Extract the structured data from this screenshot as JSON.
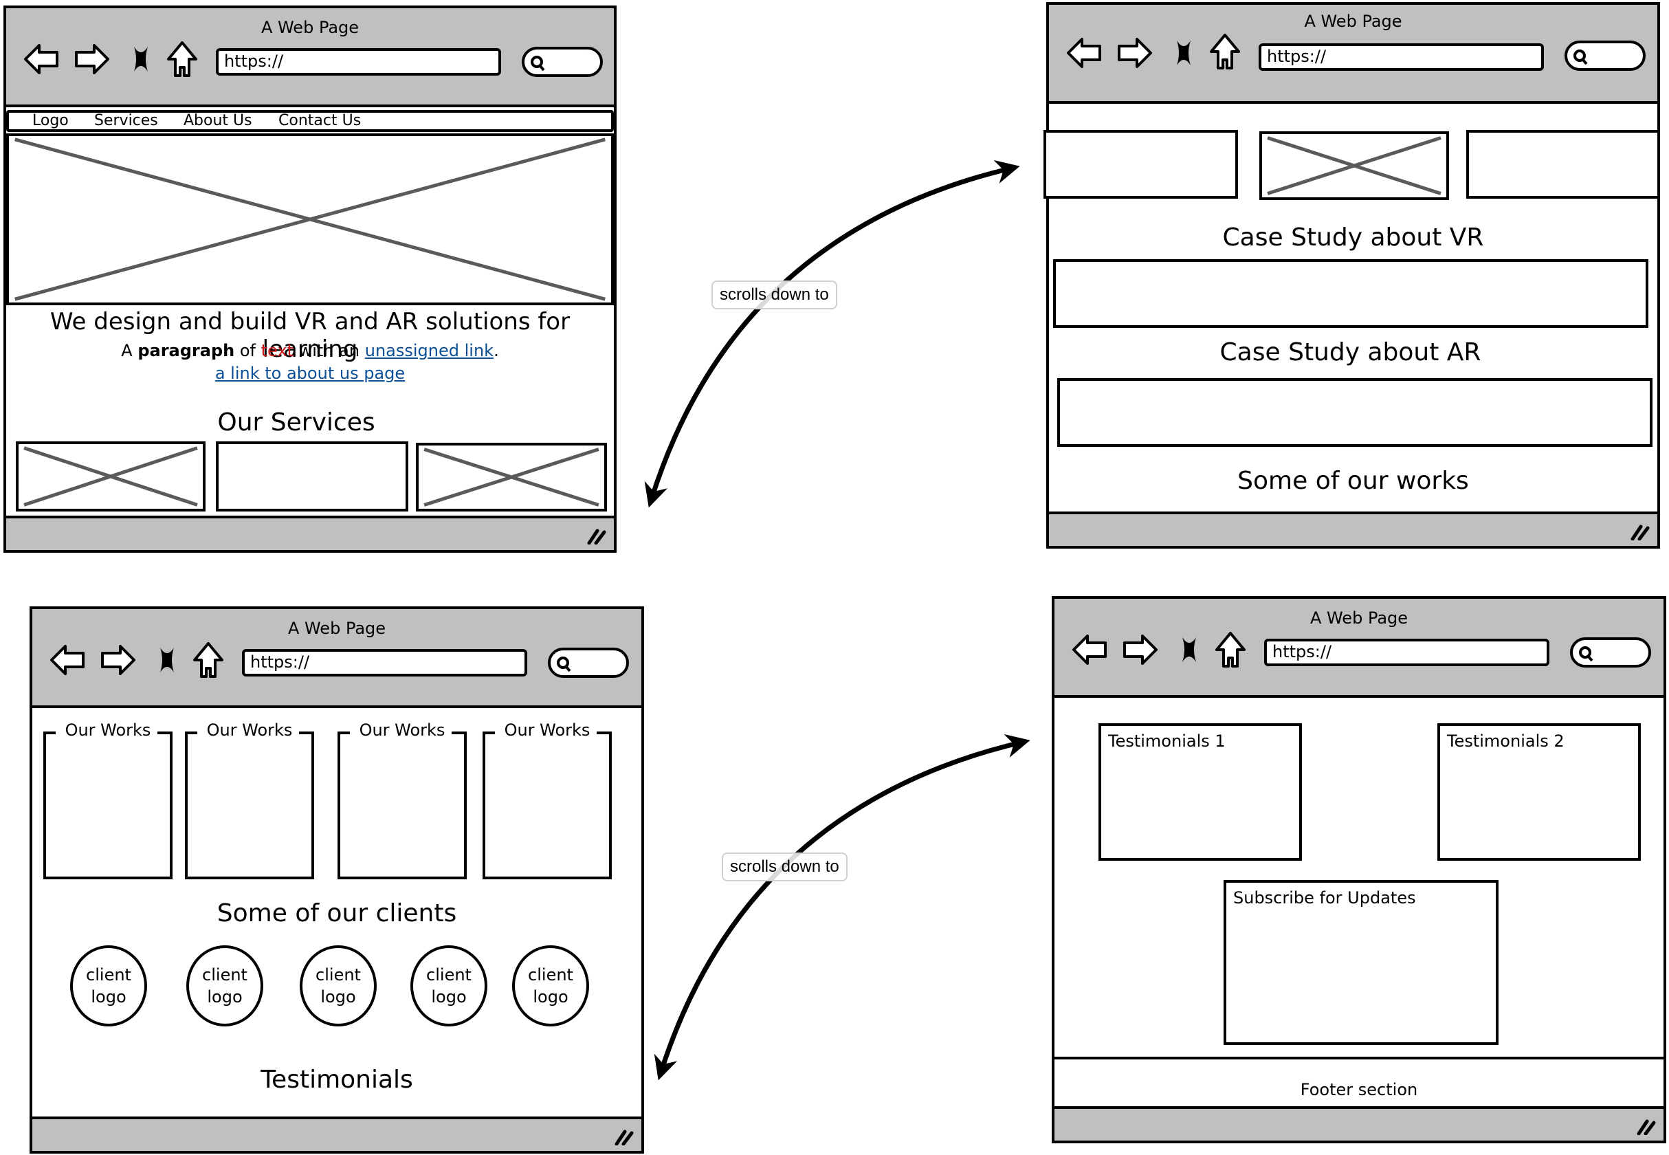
{
  "browser": {
    "title": "A Web Page",
    "url_value": "https://",
    "icons": [
      "back-arrow-icon",
      "forward-arrow-icon",
      "stop-icon",
      "home-icon",
      "search-icon",
      "resize-grip-icon"
    ]
  },
  "colors": {
    "chrome_gray": "#c0c0c0",
    "link_blue": "#0b4f96",
    "emphasis_red": "#cc1a1a",
    "placeholder_x": "#5a5a5a"
  },
  "connectors": [
    {
      "label": "scrolls down to",
      "from": "page-1-top",
      "to": "page-2-case-studies"
    },
    {
      "label": "scrolls down to",
      "from": "page-3-works",
      "to": "page-4-testimonials"
    }
  ],
  "page1": {
    "nav": [
      "Logo",
      "Services",
      "About Us",
      "Contact Us"
    ],
    "headline": "We design and build VR and AR solutions for learning",
    "paragraph": {
      "part1": "A ",
      "bold": "paragraph",
      "part2": " of ",
      "red": "text",
      "part3": " with an ",
      "link": "unassigned link",
      "part4": "."
    },
    "about_link": "a link to about us page",
    "services_heading": "Our Services"
  },
  "page2": {
    "case_vr": "Case Study about VR",
    "case_ar": "Case Study about AR",
    "works_heading": "Some of our works"
  },
  "page3": {
    "works": [
      "Our Works",
      "Our Works",
      "Our Works",
      "Our Works"
    ],
    "clients_heading": "Some of our clients",
    "clients": [
      {
        "line1": "client",
        "line2": "logo"
      },
      {
        "line1": "client",
        "line2": "logo"
      },
      {
        "line1": "client",
        "line2": "logo"
      },
      {
        "line1": "client",
        "line2": "logo"
      },
      {
        "line1": "client",
        "line2": "logo"
      }
    ],
    "testimonials_heading": "Testimonials"
  },
  "page4": {
    "testimonial1": "Testimonials 1",
    "testimonial2": "Testimonials 2",
    "subscribe": "Subscribe for Updates",
    "footer": "Footer section"
  }
}
